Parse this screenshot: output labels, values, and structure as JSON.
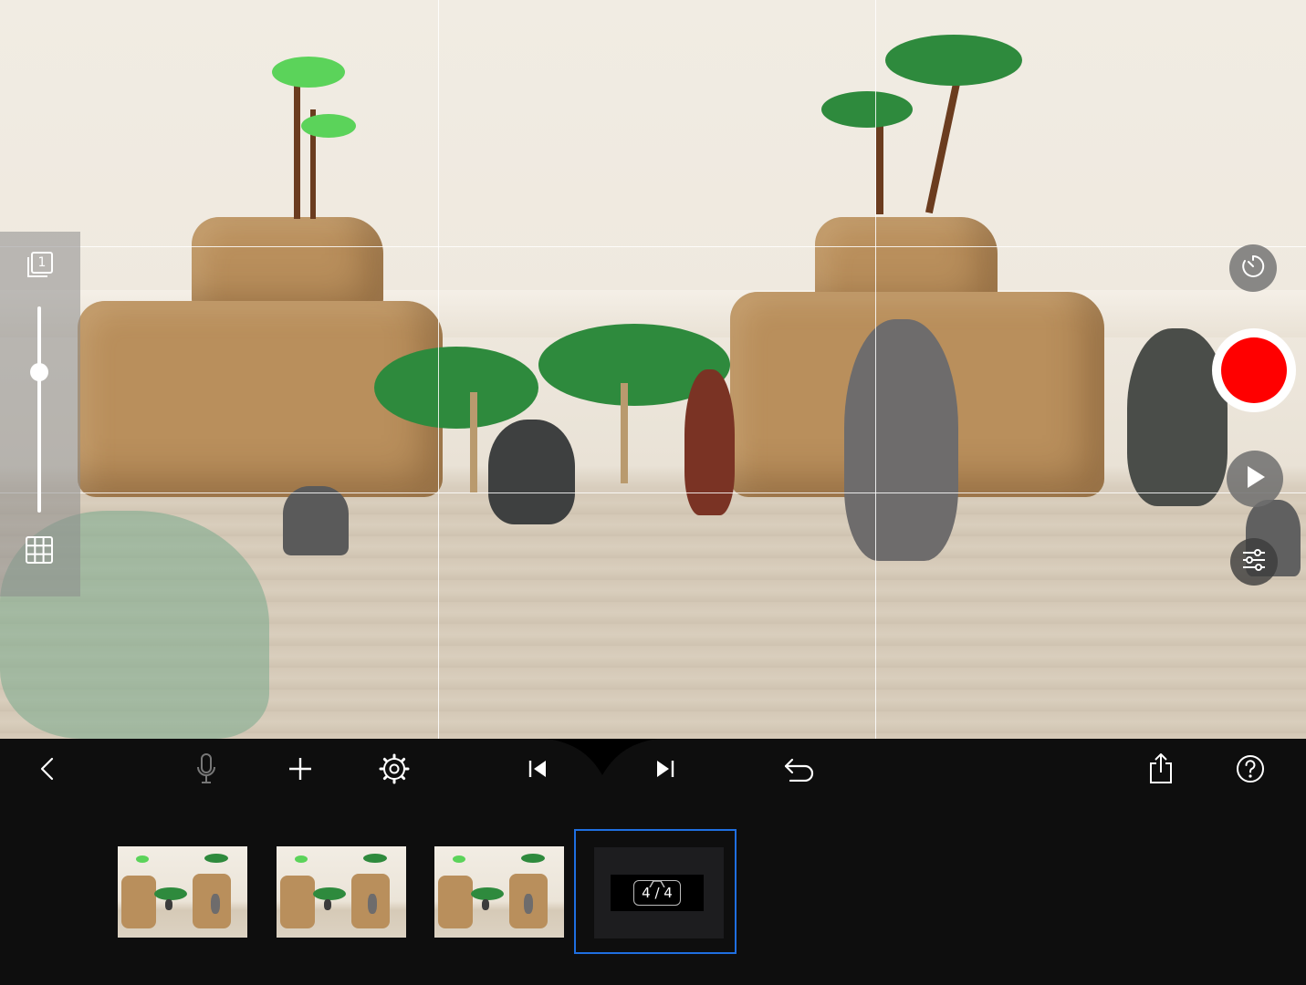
{
  "app": {
    "accent_color": "#1f6fe0",
    "record_color": "#ff0000"
  },
  "left_panel": {
    "onion_skin_icon": "onion-skin-layers-icon",
    "onion_skin_count": "1",
    "opacity_slider_level": 0.3,
    "grid_icon": "grid-icon"
  },
  "right_controls": {
    "timer_icon": "timer-icon",
    "record_icon": "record-icon",
    "play_icon": "play-icon",
    "adjust_icon": "sliders-icon"
  },
  "toolbar": {
    "back_icon": "chevron-left-icon",
    "mic_icon": "microphone-icon",
    "add_icon": "plus-icon",
    "settings_icon": "gear-icon",
    "first_frame_icon": "skip-back-icon",
    "last_frame_icon": "skip-forward-icon",
    "undo_icon": "undo-icon",
    "share_icon": "share-icon",
    "help_icon": "help-icon"
  },
  "filmstrip": {
    "frames": [
      {
        "index": 1
      },
      {
        "index": 2
      },
      {
        "index": 3
      }
    ],
    "current_frame_label": "4 / 4"
  }
}
